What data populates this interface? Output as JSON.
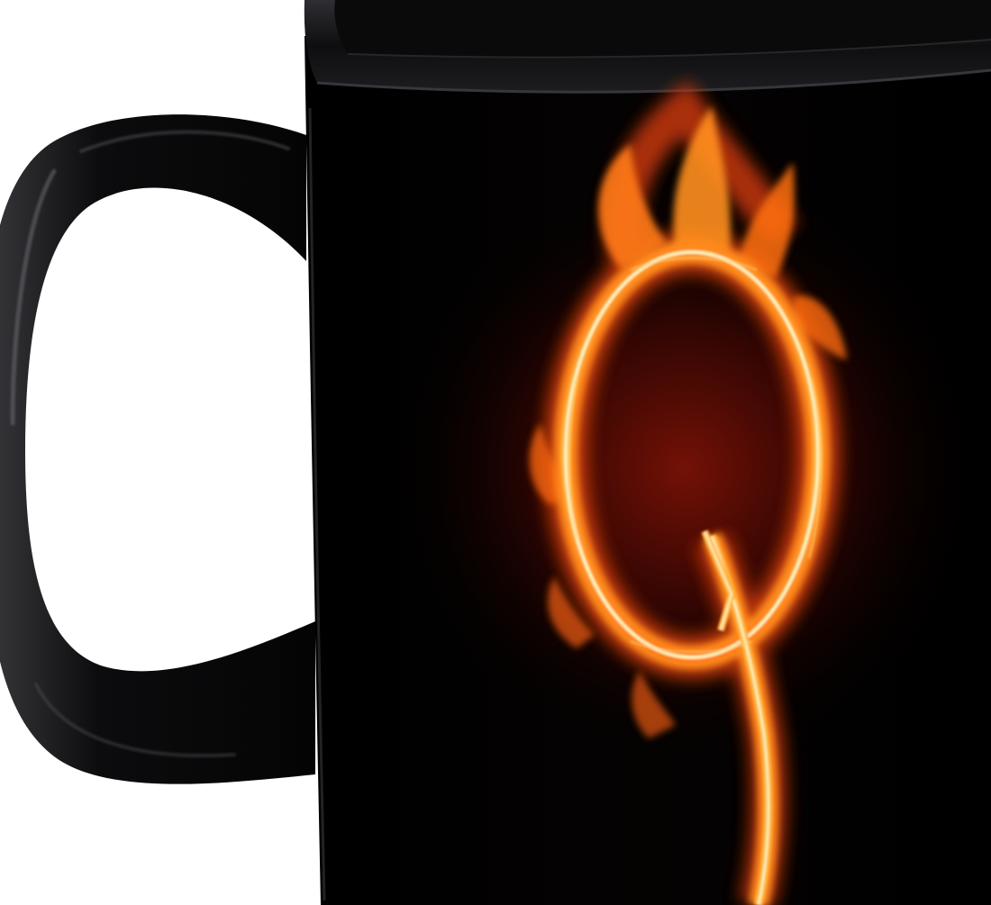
{
  "product": {
    "name": "mug",
    "mug_color": "#050505",
    "print_motif": "flaming-letter",
    "print_letter": "Q",
    "flame_colors": {
      "core": "#fff2b8",
      "mid": "#ffb13b",
      "outer": "#ff6a10",
      "deep": "#c42a05",
      "glow": "#5a0a04"
    },
    "background_color": "#ffffff"
  }
}
